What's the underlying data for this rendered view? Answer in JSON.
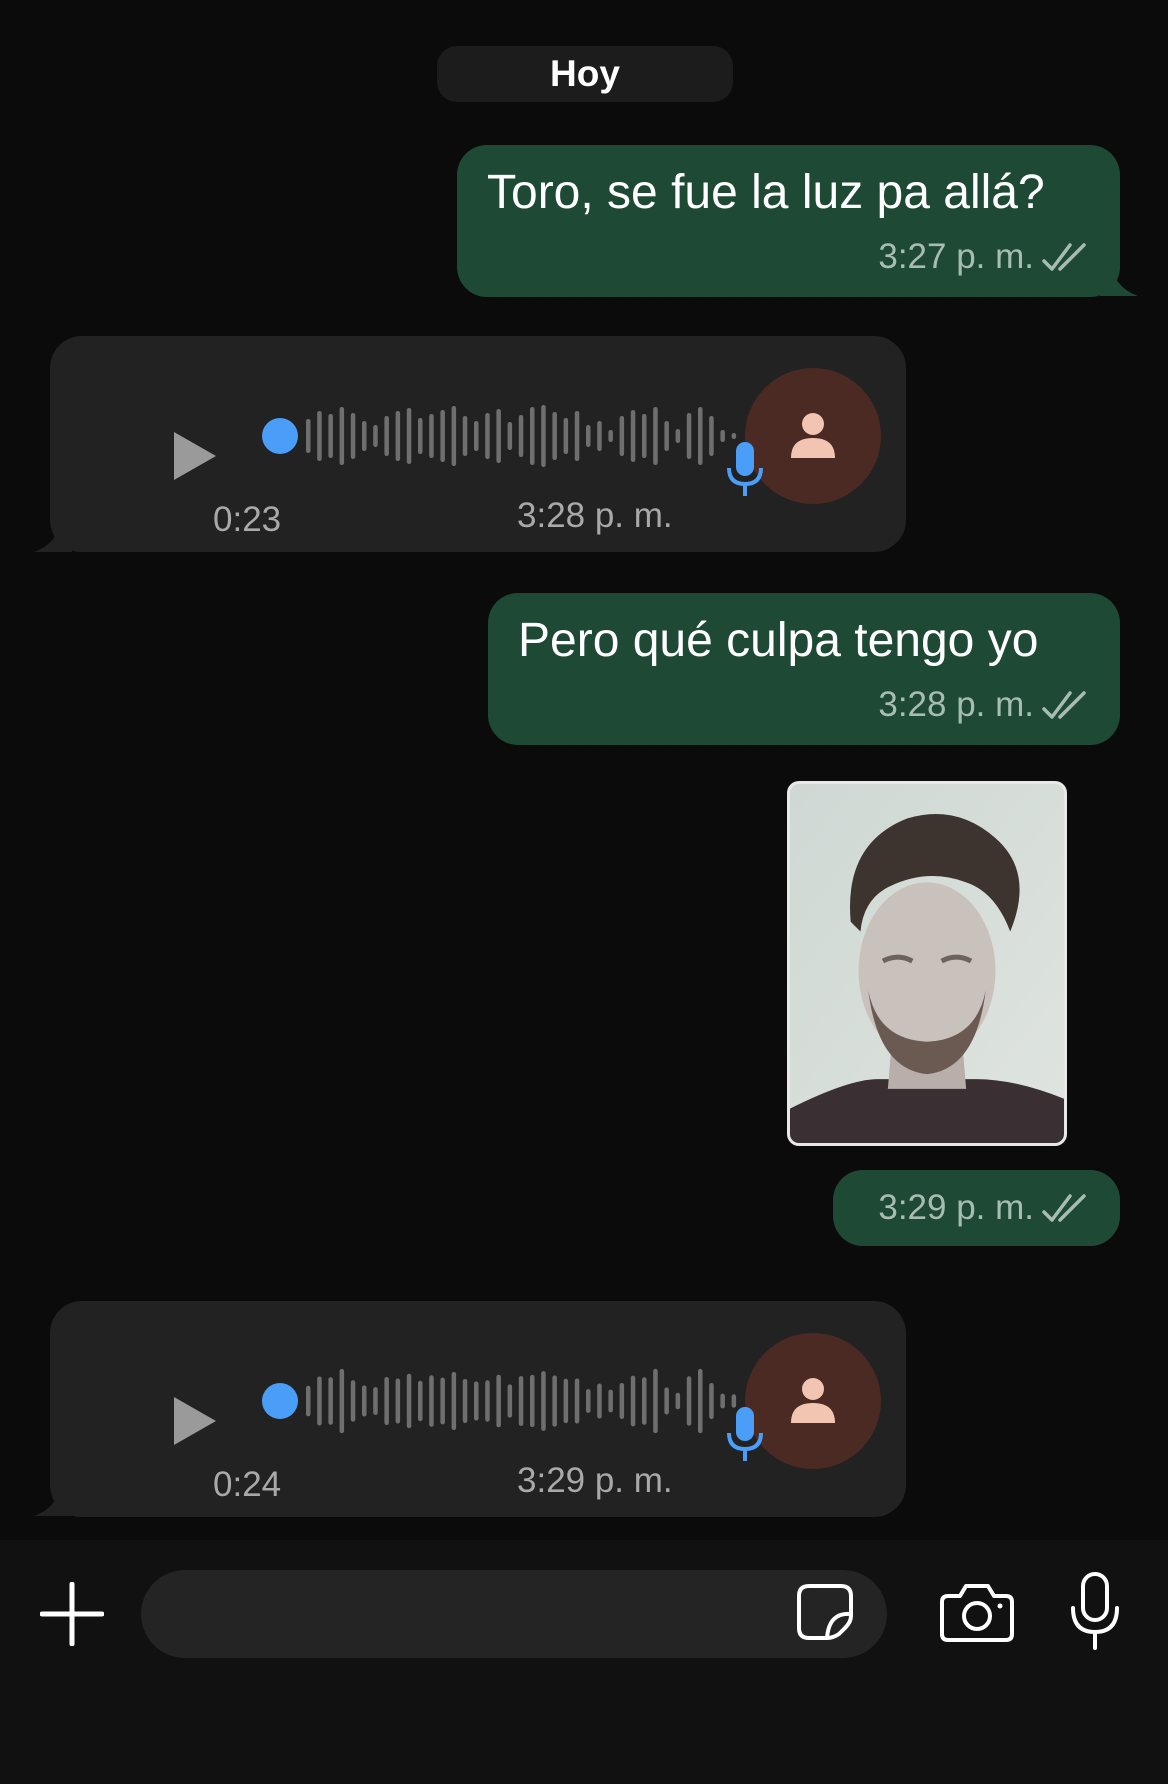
{
  "chat": {
    "date_label": "Hoy",
    "messages": [
      {
        "type": "text",
        "direction": "out",
        "text": "Toro, se fue la luz pa allá?",
        "time": "3:27 p. m.",
        "status": "read"
      },
      {
        "type": "voice",
        "direction": "in",
        "duration": "0:23",
        "time": "3:28 p. m.",
        "progress": 0
      },
      {
        "type": "text",
        "direction": "out",
        "text": "Pero qué culpa tengo yo",
        "time": "3:28 p. m.",
        "status": "read"
      },
      {
        "type": "image",
        "direction": "out",
        "time": "3:29 p. m.",
        "status": "read"
      },
      {
        "type": "voice",
        "direction": "in",
        "duration": "0:24",
        "time": "3:29 p. m.",
        "progress": 0
      }
    ]
  },
  "composer": {
    "placeholder": "",
    "icons": [
      "plus-icon",
      "sticker-icon",
      "camera-icon",
      "mic-icon"
    ]
  },
  "colors": {
    "background": "#0b0b0b",
    "outgoing_bubble": "#1e4935",
    "incoming_bubble": "#222222",
    "accent_blue": "#4a9ef7",
    "avatar_bg": "#4a2a22"
  }
}
